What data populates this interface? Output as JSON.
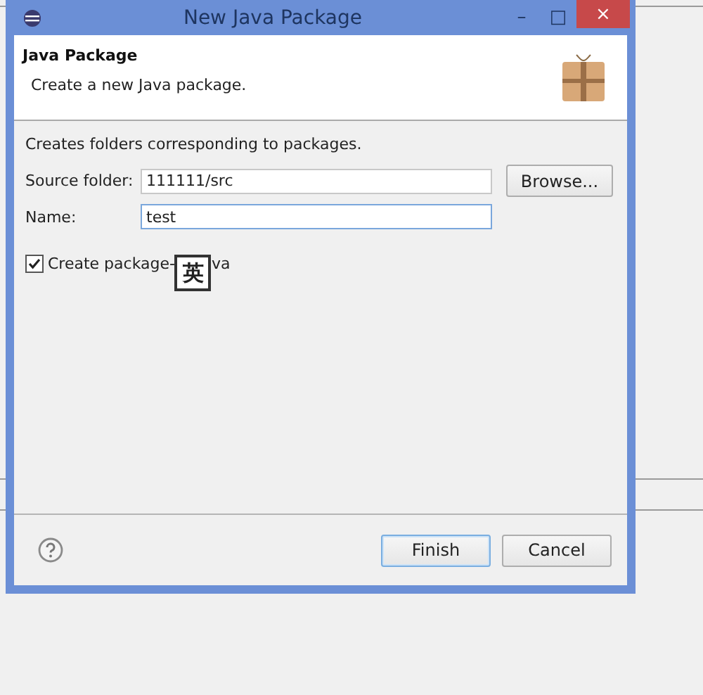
{
  "window": {
    "title": "New Java Package",
    "controls": [
      "–",
      "□",
      "×"
    ]
  },
  "header": {
    "title": "Java Package",
    "description": "Create a new Java package."
  },
  "intro": "Creates folders corresponding to packages.",
  "fields": [
    {
      "label": "Source folder:",
      "value": "111111/src",
      "focused": false,
      "button": "Browse..."
    },
    {
      "label": "Name:",
      "value": "test",
      "focused": true
    }
  ],
  "checkbox": {
    "label_visible_start": "Create package-",
    "label_visible_end": "va",
    "checked": true
  },
  "ime_indicator": "英",
  "buttons": [
    {
      "label": "Finish",
      "default": true
    },
    {
      "label": "Cancel",
      "default": false
    }
  ]
}
